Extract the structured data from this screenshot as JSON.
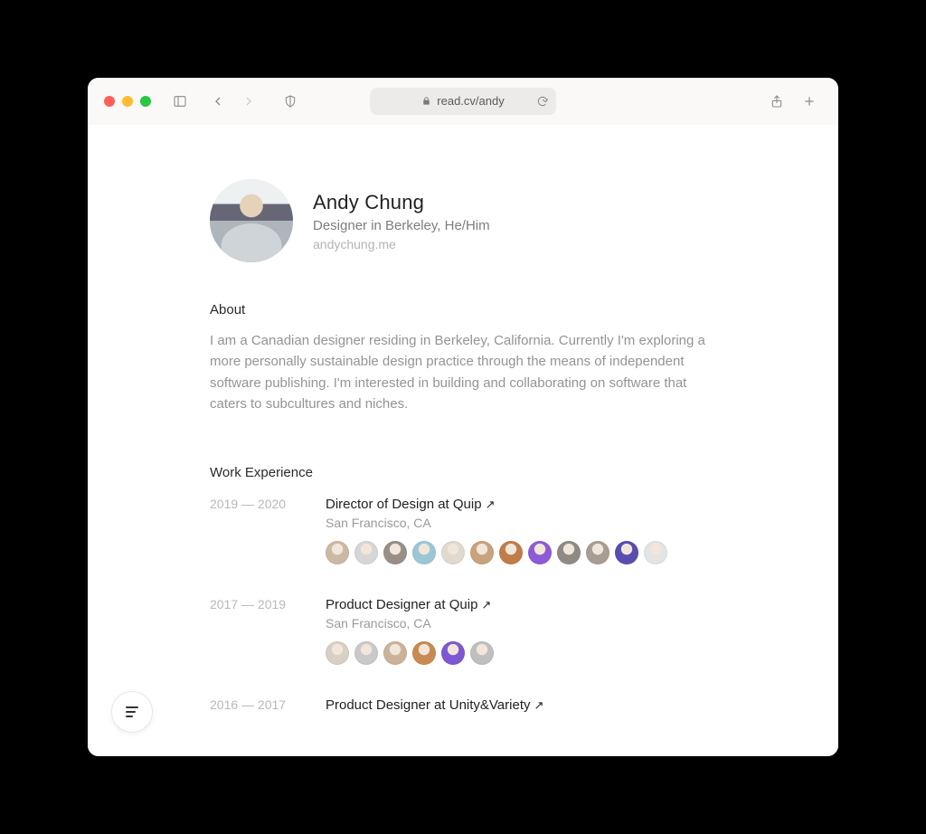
{
  "browser": {
    "url_display": "read.cv/andy"
  },
  "profile": {
    "name": "Andy Chung",
    "subtitle": "Designer in Berkeley, He/Him",
    "website": "andychung.me"
  },
  "about": {
    "heading": "About",
    "body": "I am a Canadian designer residing in Berkeley, California. Currently I'm exploring a more personally sustainable design practice through the means of independent software publishing. I'm interested in building and collaborating on software that caters to subcultures and niches."
  },
  "work": {
    "heading": "Work Experience",
    "items": [
      {
        "dates": "2019 — 2020",
        "title": "Director of Design at Quip",
        "location": "San Francisco, CA",
        "team_count": 12,
        "team_colors": [
          "#cbb9a6",
          "#d6d6d6",
          "#9a8f86",
          "#9cc6d6",
          "#e0d9cd",
          "#c9a27e",
          "#c17d49",
          "#8e5bd6",
          "#8f8a84",
          "#a89d92",
          "#5a4db0",
          "#e4e4e4"
        ]
      },
      {
        "dates": "2017 — 2019",
        "title": "Product Designer at Quip",
        "location": "San Francisco, CA",
        "team_count": 6,
        "team_colors": [
          "#d8cfc5",
          "#c9c9c9",
          "#cbb29a",
          "#c88a52",
          "#7e58d0",
          "#bfbfbf"
        ]
      },
      {
        "dates": "2016 — 2017",
        "title": "Product Designer at Unity&Variety",
        "location": "",
        "team_count": 0,
        "team_colors": []
      }
    ]
  }
}
